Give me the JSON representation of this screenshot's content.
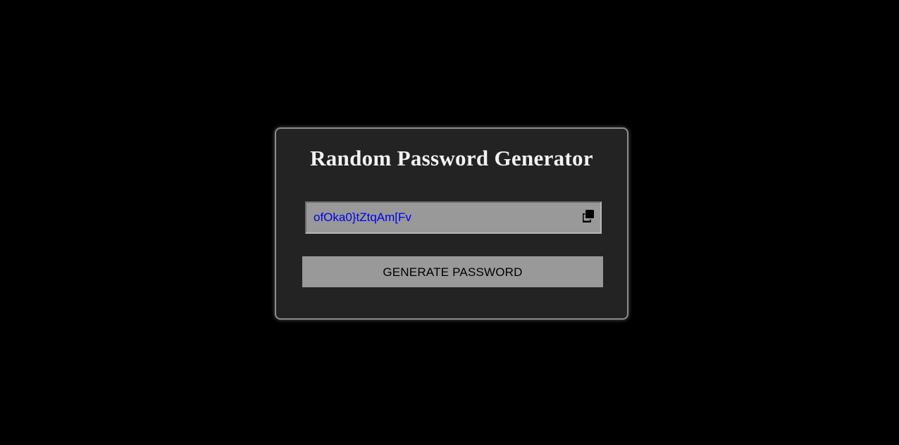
{
  "app": {
    "title": "Random Password Generator"
  },
  "password_field": {
    "value": "ofOka0}tZtqAm[Fv",
    "copy_icon": "copy-icon"
  },
  "generate_button": {
    "label": "GENERATE PASSWORD"
  },
  "colors": {
    "page_background": "#000000",
    "card_background": "#232323",
    "field_background": "#999999",
    "password_text": "#0000ee",
    "title_text": "#f2f2f2"
  }
}
